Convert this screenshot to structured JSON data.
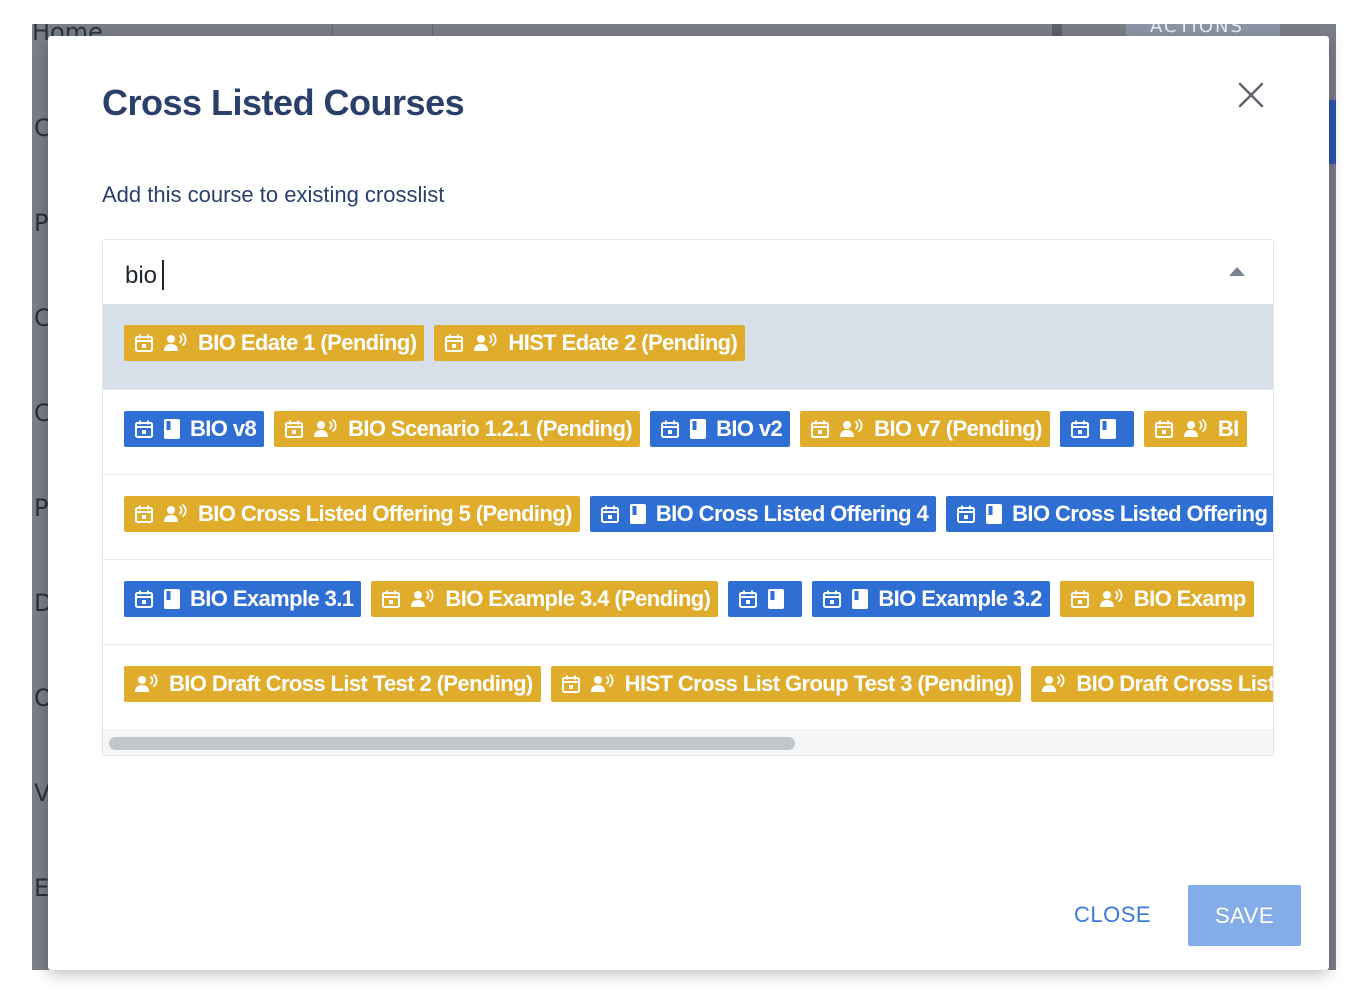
{
  "background": {
    "home_label": "Home",
    "actions_label": "ACTIONS",
    "side_letters": [
      "C",
      "P",
      "C",
      "C",
      "P",
      "D",
      "O",
      "V",
      "E"
    ]
  },
  "modal": {
    "title": "Cross Listed Courses",
    "subtitle": "Add this course to existing crosslist",
    "close_icon": "close-icon"
  },
  "search": {
    "value": "bio"
  },
  "options": [
    {
      "highlighted": true,
      "chips": [
        {
          "label": "BIO Edate 1 (Pending)",
          "color": "gold",
          "icons": [
            "calendar-icon",
            "group-icon"
          ]
        },
        {
          "label": "HIST Edate 2 (Pending)",
          "color": "gold",
          "icons": [
            "calendar-icon",
            "group-icon"
          ]
        }
      ]
    },
    {
      "highlighted": false,
      "chips": [
        {
          "label": "BIO v8",
          "color": "blue",
          "icons": [
            "calendar-icon",
            "book-icon"
          ]
        },
        {
          "label": "BIO Scenario 1.2.1 (Pending)",
          "color": "gold",
          "icons": [
            "calendar-icon",
            "group-icon"
          ]
        },
        {
          "label": "BIO v2",
          "color": "blue",
          "icons": [
            "calendar-icon",
            "book-icon"
          ]
        },
        {
          "label": "BIO v7 (Pending)",
          "color": "gold",
          "icons": [
            "calendar-icon",
            "group-icon"
          ]
        },
        {
          "label": "",
          "color": "blue",
          "icons": [
            "calendar-icon",
            "book-icon"
          ]
        },
        {
          "label": "BI",
          "color": "gold",
          "icons": [
            "calendar-icon",
            "group-icon"
          ]
        }
      ]
    },
    {
      "highlighted": false,
      "chips": [
        {
          "label": "BIO Cross Listed Offering 5 (Pending)",
          "color": "gold",
          "icons": [
            "calendar-icon",
            "group-icon"
          ]
        },
        {
          "label": "BIO Cross Listed Offering 4",
          "color": "blue",
          "icons": [
            "calendar-icon",
            "book-icon"
          ]
        },
        {
          "label": "BIO Cross Listed Offering",
          "color": "blue",
          "icons": [
            "calendar-icon",
            "book-icon"
          ]
        }
      ]
    },
    {
      "highlighted": false,
      "chips": [
        {
          "label": "BIO Example 3.1",
          "color": "blue",
          "icons": [
            "calendar-icon",
            "book-icon"
          ]
        },
        {
          "label": "BIO Example 3.4 (Pending)",
          "color": "gold",
          "icons": [
            "calendar-icon",
            "group-icon"
          ]
        },
        {
          "label": "",
          "color": "blue",
          "icons": [
            "calendar-icon",
            "book-icon"
          ]
        },
        {
          "label": "BIO Example 3.2",
          "color": "blue",
          "icons": [
            "calendar-icon",
            "book-icon"
          ]
        },
        {
          "label": "BIO Examp",
          "color": "gold",
          "icons": [
            "calendar-icon",
            "group-icon"
          ]
        }
      ]
    },
    {
      "highlighted": false,
      "chips": [
        {
          "label": "BIO Draft Cross List Test 2 (Pending)",
          "color": "gold",
          "icons": [
            "group-icon"
          ]
        },
        {
          "label": "HIST Cross List Group Test 3 (Pending)",
          "color": "gold",
          "icons": [
            "calendar-icon",
            "group-icon"
          ]
        },
        {
          "label": "BIO Draft Cross List G",
          "color": "gold",
          "icons": [
            "group-icon"
          ]
        }
      ]
    }
  ],
  "footer": {
    "close_label": "CLOSE",
    "save_label": "SAVE"
  },
  "colors": {
    "gold_chip": "#e0ac2c",
    "blue_chip": "#2f6fd4",
    "title": "#2b3f6b",
    "save_button": "#84ace8"
  }
}
